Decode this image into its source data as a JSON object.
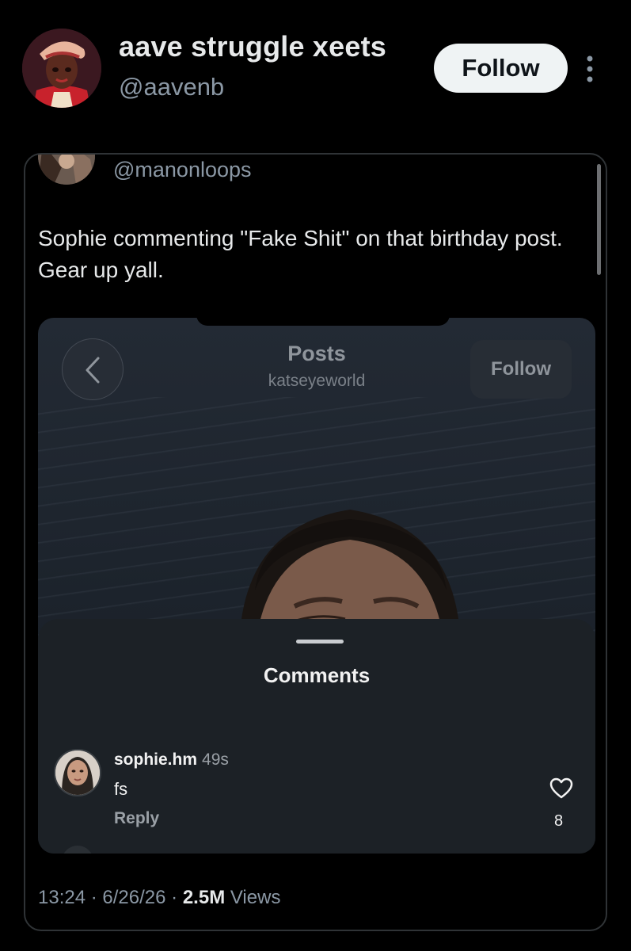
{
  "author": {
    "display_name": "aave struggle xeets",
    "handle": "@aavenb",
    "follow_label": "Follow",
    "avatar_icon": "cartoon-avatar-icon"
  },
  "more_icon": "more-vertical-icon",
  "quoted_post": {
    "handle": "@manonloops",
    "text": "Sophie commenting \"Fake Shit\" on that birthday post. Gear up yall."
  },
  "embedded_screenshot": {
    "header_title": "Posts",
    "header_username": "katseyeworld",
    "follow_label": "Follow",
    "back_icon": "chevron-left-icon",
    "comments_title": "Comments",
    "comment": {
      "username": "sophie.hm",
      "time": "49s",
      "text": "fs",
      "reply_label": "Reply",
      "like_count": "8",
      "like_icon": "heart-icon"
    }
  },
  "post_meta": {
    "time": "13:24",
    "separator": "·",
    "date": "6/26/26",
    "views_count": "2.5M",
    "views_label": "Views"
  },
  "colors": {
    "background": "#000000",
    "primary_text": "#e7e9ea",
    "secondary_text": "#8b98a5",
    "border": "#2f3336",
    "follow_button_bg": "#eff3f4"
  }
}
